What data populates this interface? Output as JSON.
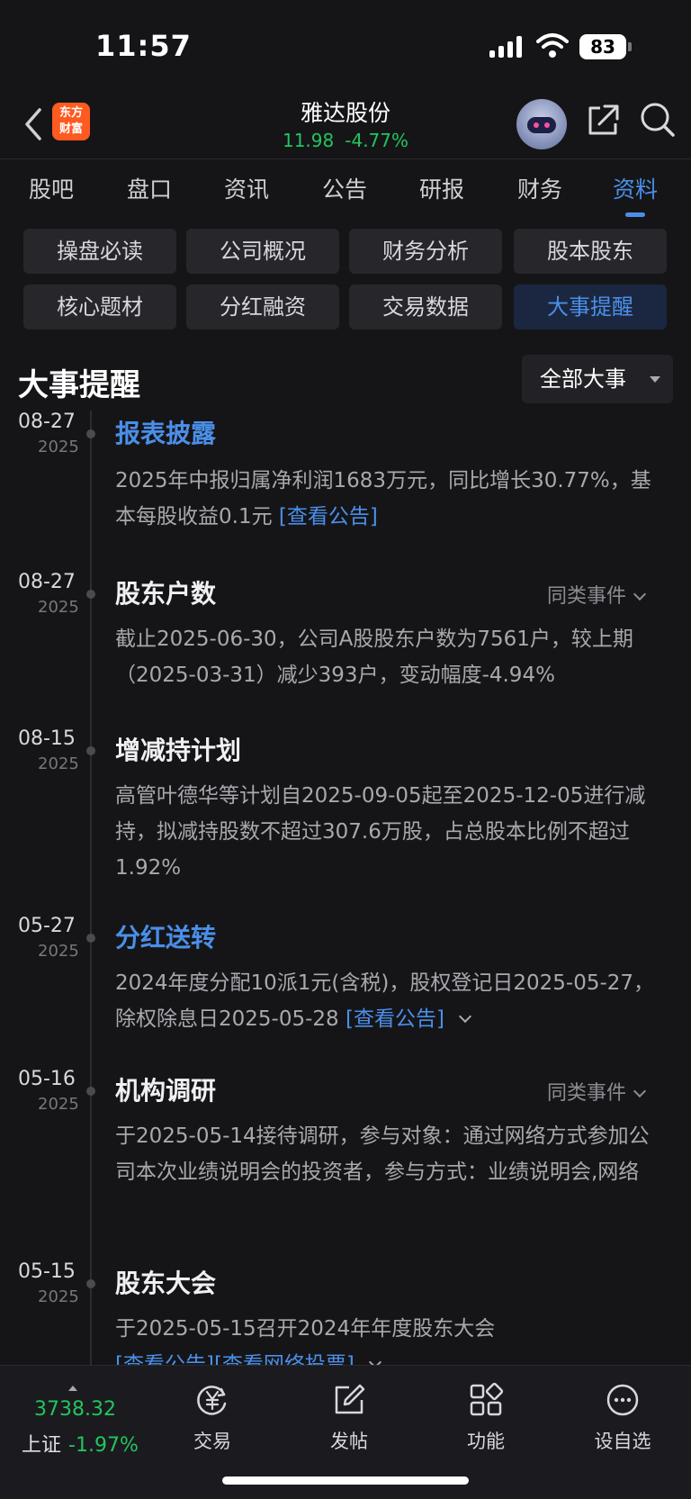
{
  "status": {
    "time": "11:57",
    "battery": "83"
  },
  "header": {
    "logo_line1": "东方",
    "logo_line2": "财富",
    "stock_name": "雅达股份",
    "price": "11.98",
    "change": "-4.77%"
  },
  "tabs": [
    "股吧",
    "盘口",
    "资讯",
    "公告",
    "研报",
    "财务",
    "资料"
  ],
  "active_tab": "资料",
  "subtabs": [
    "操盘必读",
    "公司概况",
    "财务分析",
    "股本股东",
    "核心题材",
    "分红融资",
    "交易数据",
    "大事提醒"
  ],
  "active_subtab": "大事提醒",
  "section": {
    "title": "大事提醒",
    "filter": "全部大事"
  },
  "events": [
    {
      "md": "08-27",
      "year": "2025",
      "title": "报表披露",
      "desc_text": "2025年中报归属净利润1683万元，同比增长30.77%，基本每股收益0.1元 ",
      "link1": "[查看公告]"
    },
    {
      "md": "08-27",
      "year": "2025",
      "title": "股东户数",
      "same": "同类事件",
      "desc_text": "截止2025-06-30，公司A股股东户数为7561户，较上期（2025-03-31）减少393户，变动幅度-4.94%"
    },
    {
      "md": "08-15",
      "year": "2025",
      "title": "增减持计划",
      "desc_text": "高管叶德华等计划自2025-09-05起至2025-12-05进行减持，拟减持股数不超过307.6万股，占总股本比例不超过1.92%"
    },
    {
      "md": "05-27",
      "year": "2025",
      "title": "分红送转",
      "desc_text": "2024年度分配10派1元(含税)，股权登记日2025-05-27，除权除息日2025-05-28 ",
      "link1": "[查看公告]"
    },
    {
      "md": "05-16",
      "year": "2025",
      "title": "机构调研",
      "same": "同类事件",
      "desc_text": "于2025-05-14接待调研，参与对象：通过网络方式参加公司本次业绩说明会的投资者，参与方式：业绩说明会,网络"
    },
    {
      "md": "05-15",
      "year": "2025",
      "title": "股东大会",
      "desc_text": "于2025-05-15召开2024年年度股东大会",
      "link1": "[查看公告]",
      "link2": "[查看网络投票]"
    }
  ],
  "bottom": {
    "index_value": "3738.32",
    "index_name": "上证",
    "index_change": "-1.97%",
    "nav": [
      "交易",
      "发帖",
      "功能",
      "设自选"
    ]
  }
}
